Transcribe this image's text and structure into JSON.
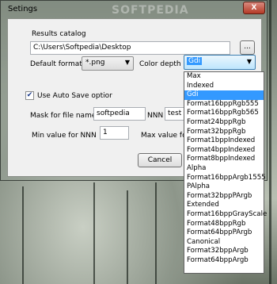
{
  "window": {
    "title": "Setings",
    "close_label": "X",
    "watermark": "SOFTPEDIA"
  },
  "results_catalog": {
    "label": "Results catalog",
    "path": "C:\\Users\\Softpedia\\Desktop",
    "browse_label": "..."
  },
  "default_format": {
    "label": "Default format",
    "value": "*.png"
  },
  "color_depth": {
    "label": "Color depth",
    "value": "Gdi",
    "options": [
      "Max",
      "Indexed",
      "Gdi",
      "Format16bppRgb555",
      "Format16bppRgb565",
      "Format24bppRgb",
      "Format32bppRgb",
      "Format1bppIndexed",
      "Format4bppIndexed",
      "Format8bppIndexed",
      "Alpha",
      "Format16bppArgb1555",
      "PAlpha",
      "Format32bppPArgb",
      "Extended",
      "Format16bppGrayScale",
      "Format48bppRgb",
      "Format64bppPArgb",
      "Canonical",
      "Format32bppArgb",
      "Format64bppArgb"
    ],
    "selected_index": 2
  },
  "auto_save": {
    "label": "Use Auto Save optior",
    "checked": true
  },
  "mask": {
    "label": "Mask for file names",
    "value": "softpedia",
    "nnn_label": "NNN",
    "suffix_value": "test"
  },
  "min_nnn": {
    "label": "Min value for NNN",
    "value": "1"
  },
  "max_nnn": {
    "label": "Max value for"
  },
  "buttons": {
    "cancel_label": "Cancel"
  }
}
